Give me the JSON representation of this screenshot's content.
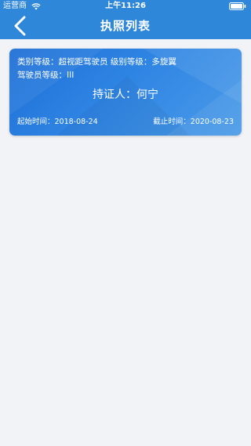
{
  "status_bar": {
    "carrier": "运营商",
    "time": "上午11:26",
    "wifi_icon": "wifi-icon",
    "battery_icon": "battery-icon"
  },
  "nav": {
    "title": "执照列表",
    "back_icon": "chevron-left-icon"
  },
  "colors": {
    "primary": "#2e87d8",
    "card_gradient_start": "#1e6fd6",
    "card_gradient_end": "#4b9be8",
    "background": "#f2f3f7"
  },
  "licenses": [
    {
      "line1": "类别等级：超视距驾驶员 级别等级：多旋翼",
      "line2": "驾驶员等级：III",
      "holder": "持证人：何宁",
      "start": "起始时间：2018-08-24",
      "end": "截止时间：2020-08-23"
    }
  ]
}
